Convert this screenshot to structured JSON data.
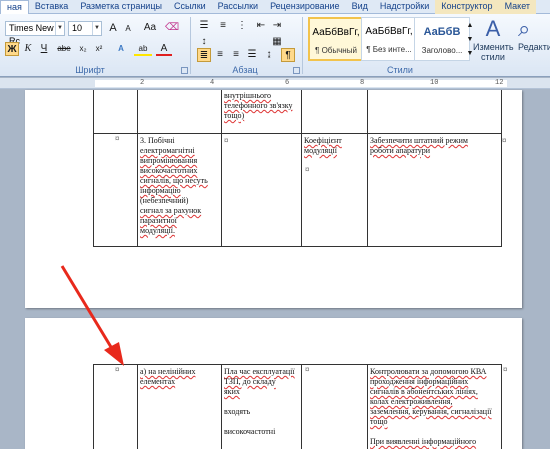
{
  "tabs": [
    "ная",
    "Вставка",
    "Разметка страницы",
    "Ссылки",
    "Рассылки",
    "Рецензирование",
    "Вид",
    "Надстройки",
    "Конструктор",
    "Макет"
  ],
  "font": {
    "name": "Times New Rc",
    "size": "10",
    "group_label": "Шрифт",
    "buttons": {
      "grow": "A",
      "shrink": "A",
      "case": "Aa",
      "bold": "Ж",
      "italic": "К",
      "underline": "Ч",
      "strike": "abe",
      "sub": "x₂",
      "sup": "x²",
      "highlight": "ab",
      "color": "A"
    }
  },
  "paragraph": {
    "group_label": "Абзац",
    "show_marks": "¶"
  },
  "styles": {
    "group_label": "Стили",
    "items": [
      {
        "sample": "АаБбВвГг,",
        "name": "¶ Обычный"
      },
      {
        "sample": "АаБбВвГг,",
        "name": "¶ Без инте..."
      },
      {
        "sample": "АаБбВ",
        "name": "Заголово..."
      }
    ],
    "change_styles": "Изменить стили",
    "editing": "Редактир"
  },
  "colors": {
    "highlight": "#ffe600",
    "font_color": "#e02020",
    "arrow": "#e8291c"
  },
  "document": {
    "page1": {
      "row1_col3": [
        "внутрішнього",
        "телефонного зв'язку",
        "тощо)"
      ],
      "row2_col2": [
        "3. Побічні",
        "електромагнітні",
        "випромінювання",
        "високочастотних",
        "сигналів, що несуть",
        "інформацію",
        "(небезпечний)",
        "сигнал за рахунок",
        "паразитної",
        "модуляції."
      ],
      "row2_col4": [
        "Коефіцієнт",
        "модуляції"
      ],
      "row2_col5": [
        "Забезпечити штатний режим",
        "роботи апаратури"
      ]
    },
    "page2": {
      "col2": [
        "а) на нелінійних",
        "елементах"
      ],
      "col3": [
        "Пла час експлуатації",
        "ТЗП, до складу",
        "яких",
        "",
        "входять",
        "",
        "високочастотні"
      ],
      "col5": [
        "Контролювати за допомогою КВА",
        "проходження інформаційних",
        "сигналів в абонентських лініях,",
        "колах електроживлення,",
        "заземлення, керування, сигналізації",
        "тощо",
        "",
        "При виявленні інформаційного"
      ]
    }
  }
}
